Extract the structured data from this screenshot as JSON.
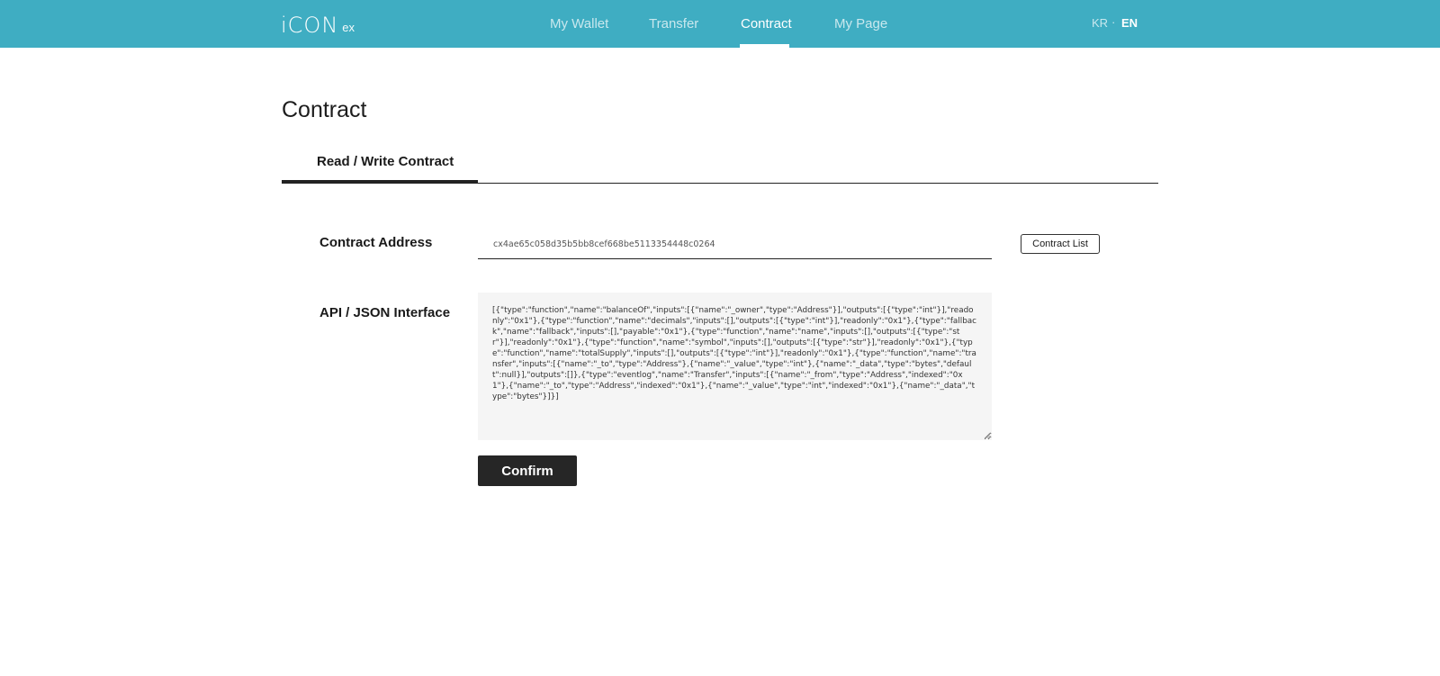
{
  "header": {
    "logo_main": "iCON",
    "logo_sub": "ex",
    "nav": [
      {
        "label": "My Wallet",
        "active": false
      },
      {
        "label": "Transfer",
        "active": false
      },
      {
        "label": "Contract",
        "active": true
      },
      {
        "label": "My Page",
        "active": false
      }
    ],
    "languages": [
      {
        "label": "KR",
        "active": false
      },
      {
        "label": "EN",
        "active": true
      }
    ],
    "lang_separator": "·",
    "background_color": "#3fadc2"
  },
  "page": {
    "title": "Contract",
    "tab_label": "Read / Write Contract"
  },
  "form": {
    "address_label": "Contract Address",
    "address_value": "cx4ae65c058d35b5bb8cef668be5113354448c0264",
    "contract_list_label": "Contract List",
    "api_label": "API / JSON Interface",
    "api_value": "[{\"type\":\"function\",\"name\":\"balanceOf\",\"inputs\":[{\"name\":\"_owner\",\"type\":\"Address\"}],\"outputs\":[{\"type\":\"int\"}],\"readonly\":\"0x1\"},{\"type\":\"function\",\"name\":\"decimals\",\"inputs\":[],\"outputs\":[{\"type\":\"int\"}],\"readonly\":\"0x1\"},{\"type\":\"fallback\",\"name\":\"fallback\",\"inputs\":[],\"payable\":\"0x1\"},{\"type\":\"function\",\"name\":\"name\",\"inputs\":[],\"outputs\":[{\"type\":\"str\"}],\"readonly\":\"0x1\"},{\"type\":\"function\",\"name\":\"symbol\",\"inputs\":[],\"outputs\":[{\"type\":\"str\"}],\"readonly\":\"0x1\"},{\"type\":\"function\",\"name\":\"totalSupply\",\"inputs\":[],\"outputs\":[{\"type\":\"int\"}],\"readonly\":\"0x1\"},{\"type\":\"function\",\"name\":\"transfer\",\"inputs\":[{\"name\":\"_to\",\"type\":\"Address\"},{\"name\":\"_value\",\"type\":\"int\"},{\"name\":\"_data\",\"type\":\"bytes\",\"default\":null}],\"outputs\":[]},{\"type\":\"eventlog\",\"name\":\"Transfer\",\"inputs\":[{\"name\":\"_from\",\"type\":\"Address\",\"indexed\":\"0x1\"},{\"name\":\"_to\",\"type\":\"Address\",\"indexed\":\"0x1\"},{\"name\":\"_value\",\"type\":\"int\",\"indexed\":\"0x1\"},{\"name\":\"_data\",\"type\":\"bytes\"}]}]",
    "confirm_label": "Confirm"
  }
}
